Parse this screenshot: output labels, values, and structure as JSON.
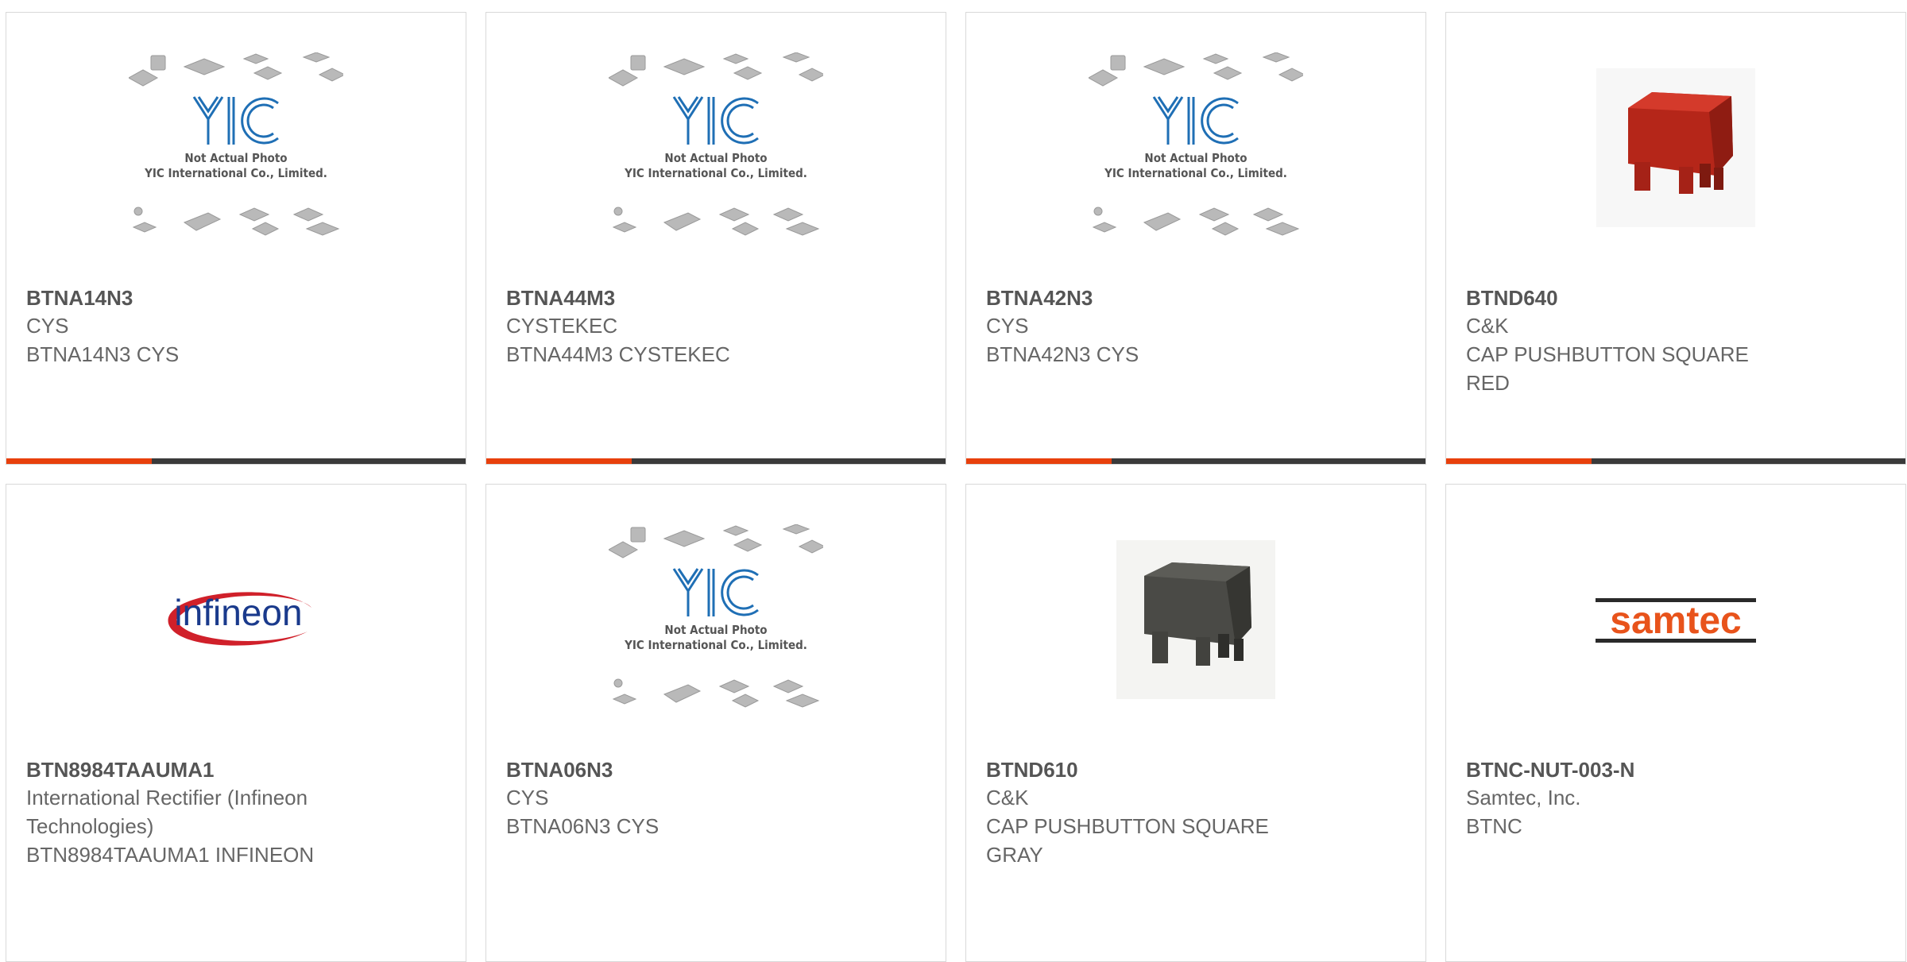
{
  "products": [
    {
      "part": "BTNA14N3",
      "manufacturer": "CYS",
      "description": [
        "BTNA14N3 CYS"
      ],
      "image": "yic-placeholder"
    },
    {
      "part": "BTNA44M3",
      "manufacturer": "CYSTEKEC",
      "description": [
        "BTNA44M3 CYSTEKEC"
      ],
      "image": "yic-placeholder"
    },
    {
      "part": "BTNA42N3",
      "manufacturer": "CYS",
      "description": [
        "BTNA42N3 CYS"
      ],
      "image": "yic-placeholder"
    },
    {
      "part": "BTND640",
      "manufacturer": "C&K",
      "description": [
        "CAP PUSHBUTTON SQUARE",
        "RED"
      ],
      "image": "red-cap"
    },
    {
      "part": "BTN8984TAAUMA1",
      "manufacturer": "International Rectifier (Infineon Technologies)",
      "manufacturer_lines": [
        "International Rectifier (Infineon",
        "Technologies)"
      ],
      "description": [
        "BTN8984TAAUMA1 INFINEON"
      ],
      "image": "infineon-logo"
    },
    {
      "part": "BTNA06N3",
      "manufacturer": "CYS",
      "description": [
        "BTNA06N3 CYS"
      ],
      "image": "yic-placeholder"
    },
    {
      "part": "BTND610",
      "manufacturer": "C&K",
      "description": [
        "CAP PUSHBUTTON SQUARE",
        "GRAY"
      ],
      "image": "gray-cap"
    },
    {
      "part": "BTNC-NUT-003-N",
      "manufacturer": "Samtec, Inc.",
      "description": [
        "BTNC"
      ],
      "image": "samtec-logo"
    }
  ],
  "placeholder": {
    "logo_text": "YIC",
    "caption_line1": "Not Actual Photo",
    "caption_line2": "YIC International Co., Limited."
  },
  "logos": {
    "infineon": "infineon",
    "samtec": "samtec"
  },
  "colors": {
    "accent": "#e8400c",
    "bar": "#3a3a3a",
    "yic_blue": "#1f6fb5",
    "cap_red": "#c22c1f",
    "cap_gray": "#4a4a46",
    "infineon_blue": "#1a3a8c",
    "infineon_red": "#d0202a",
    "samtec_orange": "#e8531b"
  }
}
